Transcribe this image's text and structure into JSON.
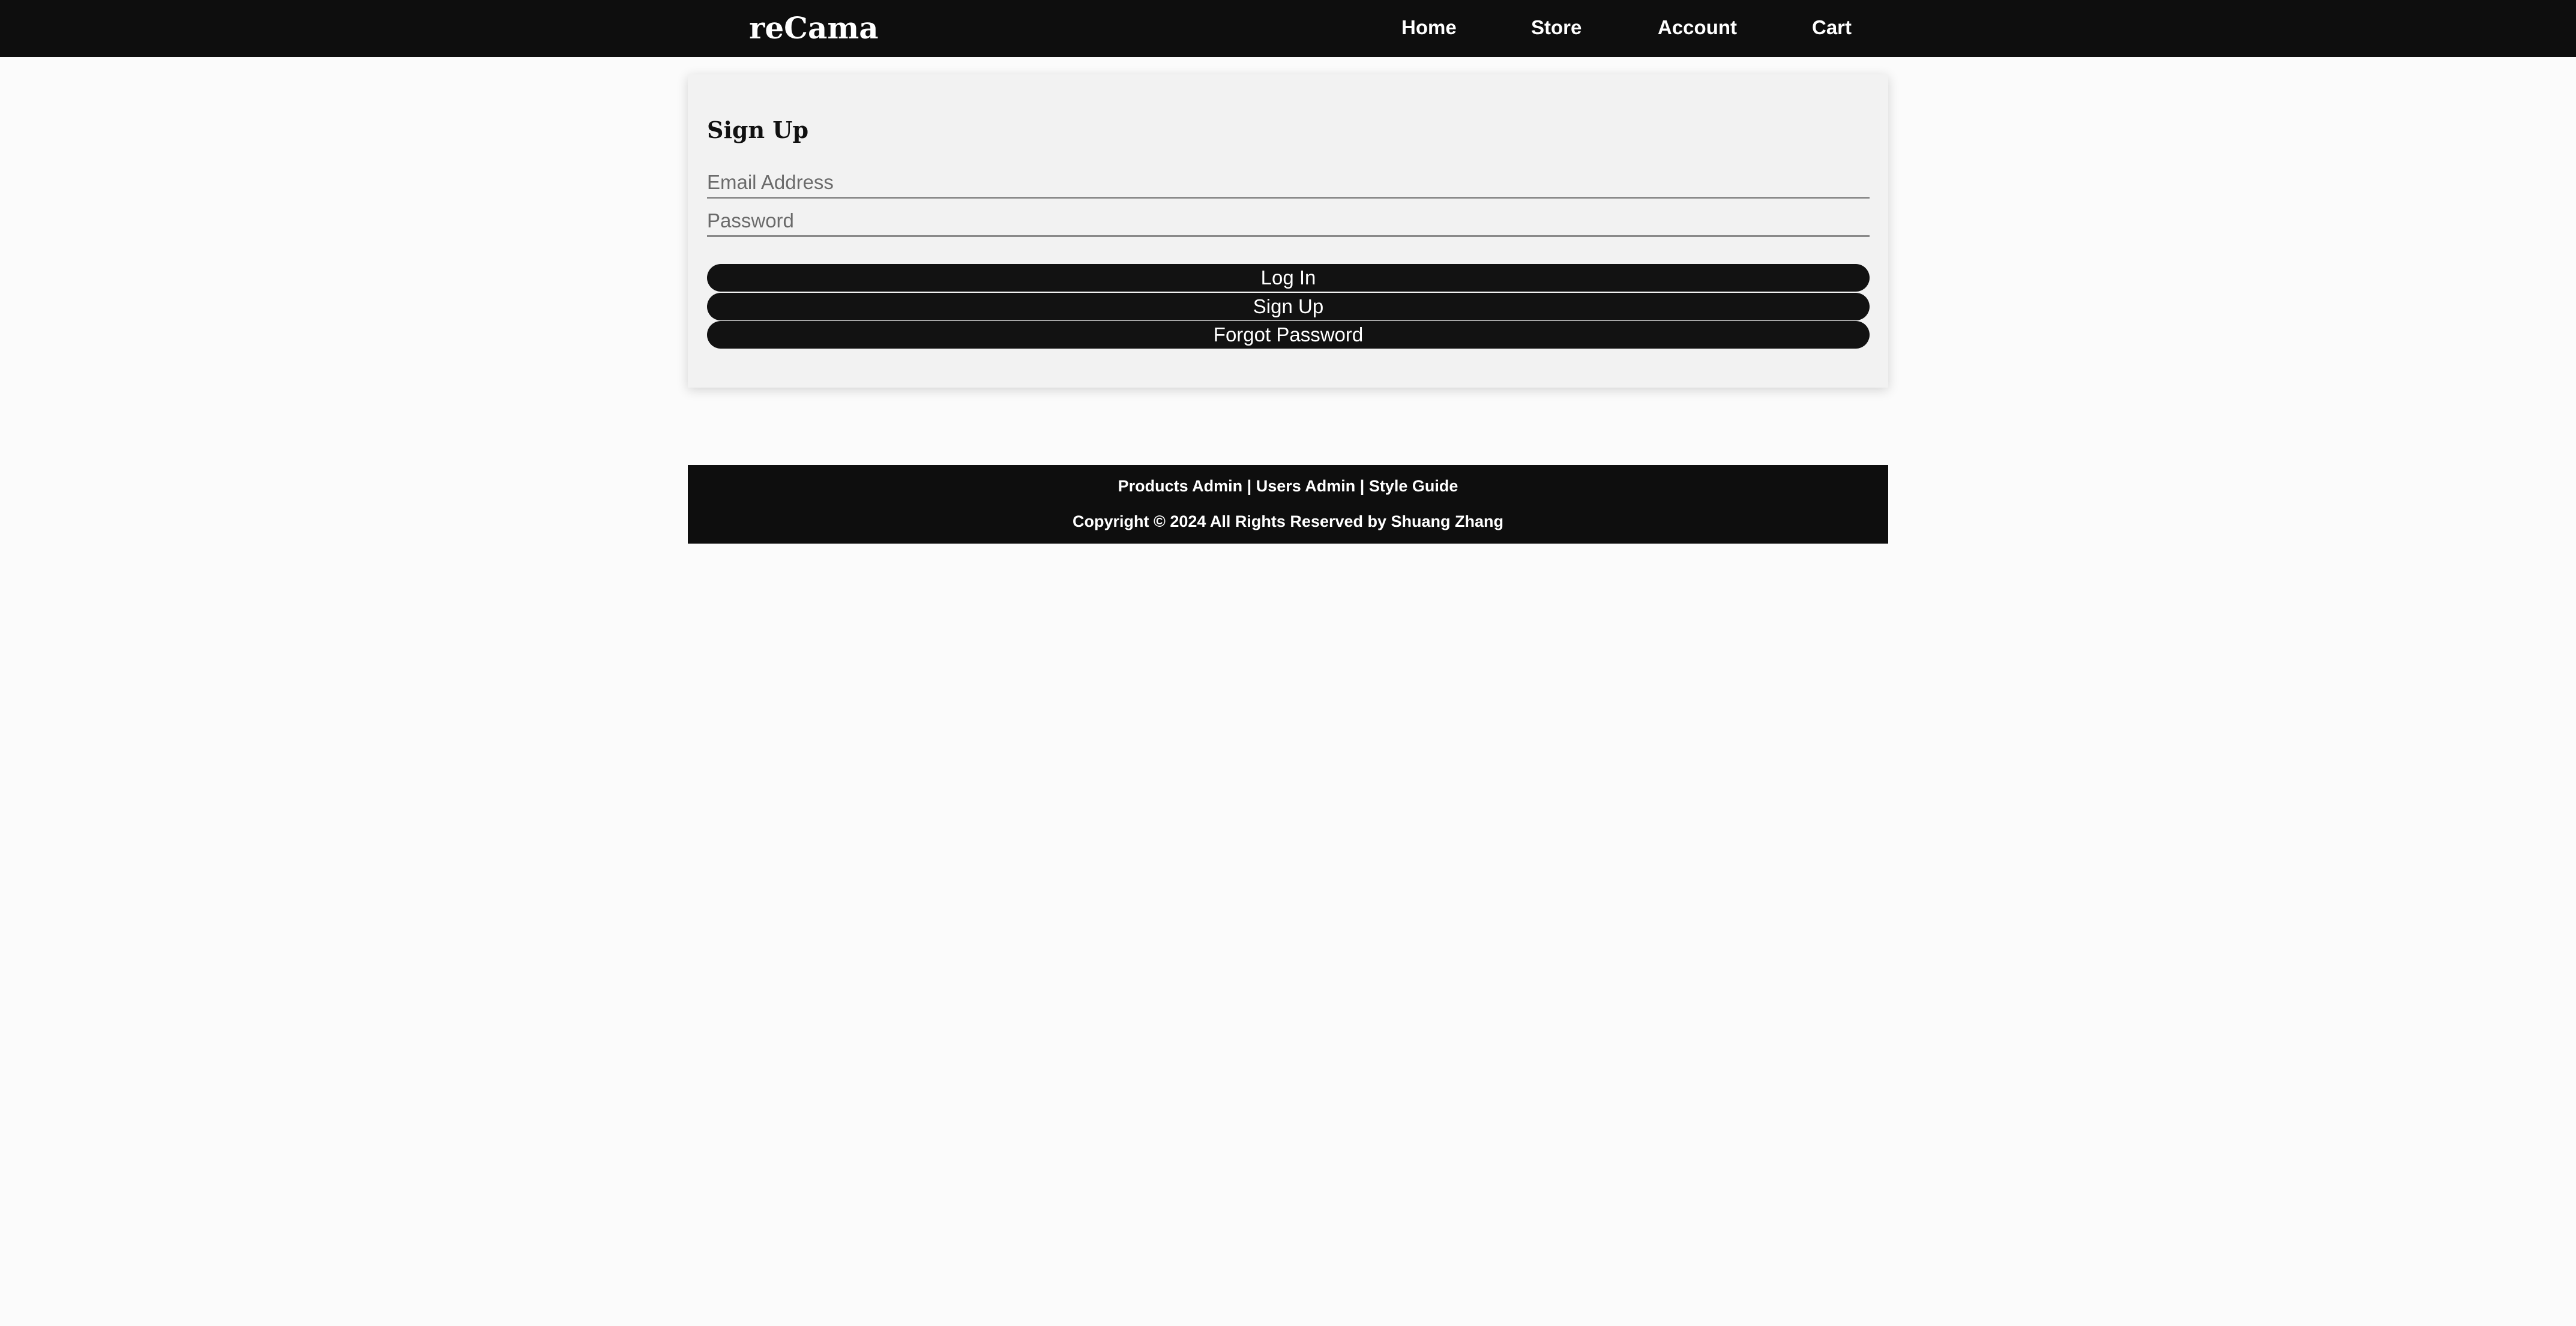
{
  "header": {
    "brand": "reCama",
    "nav": {
      "home": "Home",
      "store": "Store",
      "account": "Account",
      "cart": "Cart"
    }
  },
  "signup_card": {
    "title": "Sign Up",
    "email_placeholder": "Email Address",
    "password_placeholder": "Password",
    "login_label": "Log In",
    "signup_label": "Sign Up",
    "forgot_label": "Forgot Password"
  },
  "footer": {
    "products_admin": "Products Admin",
    "separator": "|",
    "users_admin": "Users Admin",
    "style_guide": "Style Guide",
    "copyright": "Copyright © 2024 All Rights Reserved by Shuang Zhang"
  },
  "colors": {
    "header_bg": "#0e0e0e",
    "page_bg": "#fbfbfb",
    "card_bg": "#f2f2f2",
    "button_bg": "#121212"
  }
}
